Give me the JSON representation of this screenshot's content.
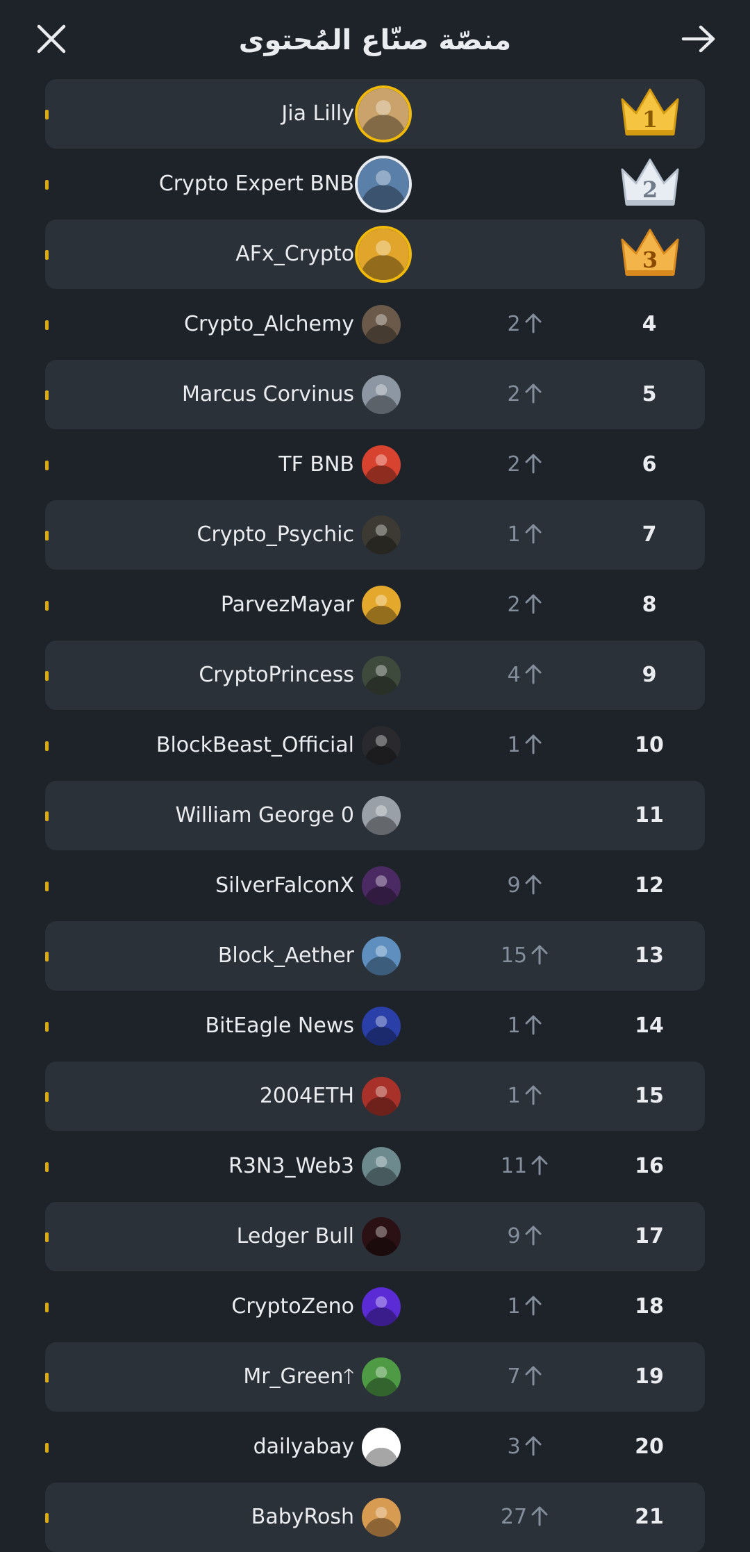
{
  "header": {
    "title": "منصّة صنّاع المُحتوى",
    "close_icon": "close-icon",
    "back_icon": "arrow-right-icon"
  },
  "colors": {
    "background": "#1e2329",
    "row_alt": "#2b3139",
    "accent": "#f0b90b",
    "muted": "#848e9c"
  },
  "rows": [
    {
      "rank": "1",
      "name": "Jia Lilly",
      "change": "",
      "crown": "gold",
      "avatar_color": "#c9a36b"
    },
    {
      "rank": "2",
      "name": "Crypto Expert BNB",
      "change": "",
      "crown": "silver",
      "avatar_color": "#5a7fa8"
    },
    {
      "rank": "3",
      "name": "AFx_Crypto",
      "change": "",
      "crown": "bronze",
      "avatar_color": "#e0a52a"
    },
    {
      "rank": "4",
      "name": "Crypto_Alchemy",
      "change": "2",
      "avatar_color": "#6b5a4a"
    },
    {
      "rank": "5",
      "name": "Marcus Corvinus",
      "change": "2",
      "avatar_color": "#8d96a3"
    },
    {
      "rank": "6",
      "name": "TF BNB",
      "change": "2",
      "avatar_color": "#d8432f"
    },
    {
      "rank": "7",
      "name": "Crypto_Psychic",
      "change": "1",
      "avatar_color": "#3d3a33"
    },
    {
      "rank": "8",
      "name": "ParvezMayar",
      "change": "2",
      "avatar_color": "#e4a92c"
    },
    {
      "rank": "9",
      "name": "CryptoPrincess",
      "change": "4",
      "avatar_color": "#3e4a3c"
    },
    {
      "rank": "10",
      "name": "BlockBeast_Official",
      "change": "1",
      "avatar_color": "#2a2a2e"
    },
    {
      "rank": "11",
      "name": "William George 0",
      "change": "",
      "avatar_color": "#9aa0a8"
    },
    {
      "rank": "12",
      "name": "SilverFalconX",
      "change": "9",
      "avatar_color": "#4b2a63"
    },
    {
      "rank": "13",
      "name": "Block_Aether",
      "change": "15",
      "avatar_color": "#5e8fbf"
    },
    {
      "rank": "14",
      "name": "BitEagle News",
      "change": "1",
      "avatar_color": "#2a3fa8"
    },
    {
      "rank": "15",
      "name": "2004ETH",
      "change": "1",
      "avatar_color": "#a8322a"
    },
    {
      "rank": "16",
      "name": "R3N3_Web3",
      "change": "11",
      "avatar_color": "#6d8a8f"
    },
    {
      "rank": "17",
      "name": "Ledger Bull",
      "change": "9",
      "avatar_color": "#2b1114"
    },
    {
      "rank": "18",
      "name": "CryptoZeno",
      "change": "1",
      "avatar_color": "#5b2bd6"
    },
    {
      "rank": "19",
      "name": "Mr_Green🡑",
      "change": "7",
      "avatar_color": "#4f9a45"
    },
    {
      "rank": "20",
      "name": "dailyabay",
      "change": "3",
      "avatar_color": "#ffffff"
    },
    {
      "rank": "21",
      "name": "BabyRosh",
      "change": "27",
      "avatar_color": "#d89b52"
    }
  ]
}
